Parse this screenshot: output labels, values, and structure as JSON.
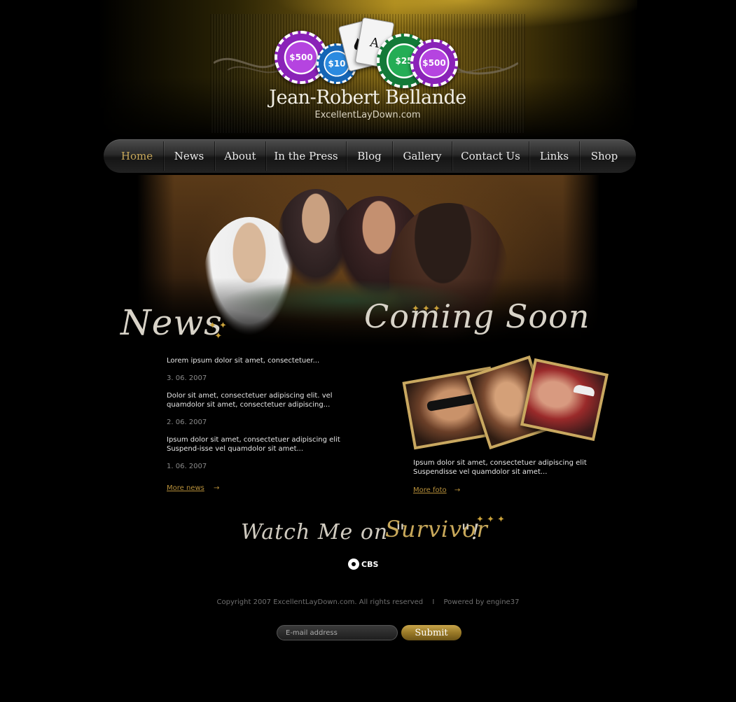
{
  "header": {
    "site_name": "Jean-Robert Bellande",
    "site_url": "ExcellentLayDown.com",
    "chips": [
      "$500",
      "$10",
      "$25",
      "$500"
    ],
    "card_rank": "A",
    "card_suit": "♠"
  },
  "nav": {
    "items": [
      {
        "label": "Home",
        "active": true
      },
      {
        "label": "News"
      },
      {
        "label": "About"
      },
      {
        "label": "In the Press"
      },
      {
        "label": "Blog"
      },
      {
        "label": "Gallery"
      },
      {
        "label": "Contact Us"
      },
      {
        "label": "Links"
      },
      {
        "label": "Shop"
      }
    ]
  },
  "news": {
    "heading": "News",
    "items": [
      {
        "text": "Lorem ipsum dolor sit amet, consectetuer...",
        "date": "3. 06. 2007"
      },
      {
        "text": "Dolor sit amet, consectetuer adipiscing elit. vel quamdolor sit amet, consectetuer adipiscing...",
        "date": "2. 06. 2007"
      },
      {
        "text": "Ipsum dolor sit amet, consectetuer adipiscing elit Suspend-isse vel quamdolor sit amet...",
        "date": "1. 06. 2007"
      }
    ],
    "more_label": "More news"
  },
  "coming_soon": {
    "heading": "Coming Soon",
    "text": "Ipsum dolor sit amet, consectetuer adipiscing elit Suspendisse vel quamdolor sit amet...",
    "more_label": "More foto"
  },
  "promo": {
    "prefix": "Watch Me on \"",
    "show": "Survivor",
    "suffix": "\"!",
    "network": "CBS"
  },
  "footer": {
    "copyright": "Copyright 2007 ExcellentLayDown.com. All rights reserved",
    "separator": "I",
    "powered": "Powered by engine37",
    "email_placeholder": "E-mail address",
    "submit_label": "Submit"
  },
  "colors": {
    "accent_gold": "#c8a85a",
    "chip_purple": "#9b2fc9",
    "chip_blue": "#1e7fd6",
    "chip_green": "#1f9a4a"
  }
}
